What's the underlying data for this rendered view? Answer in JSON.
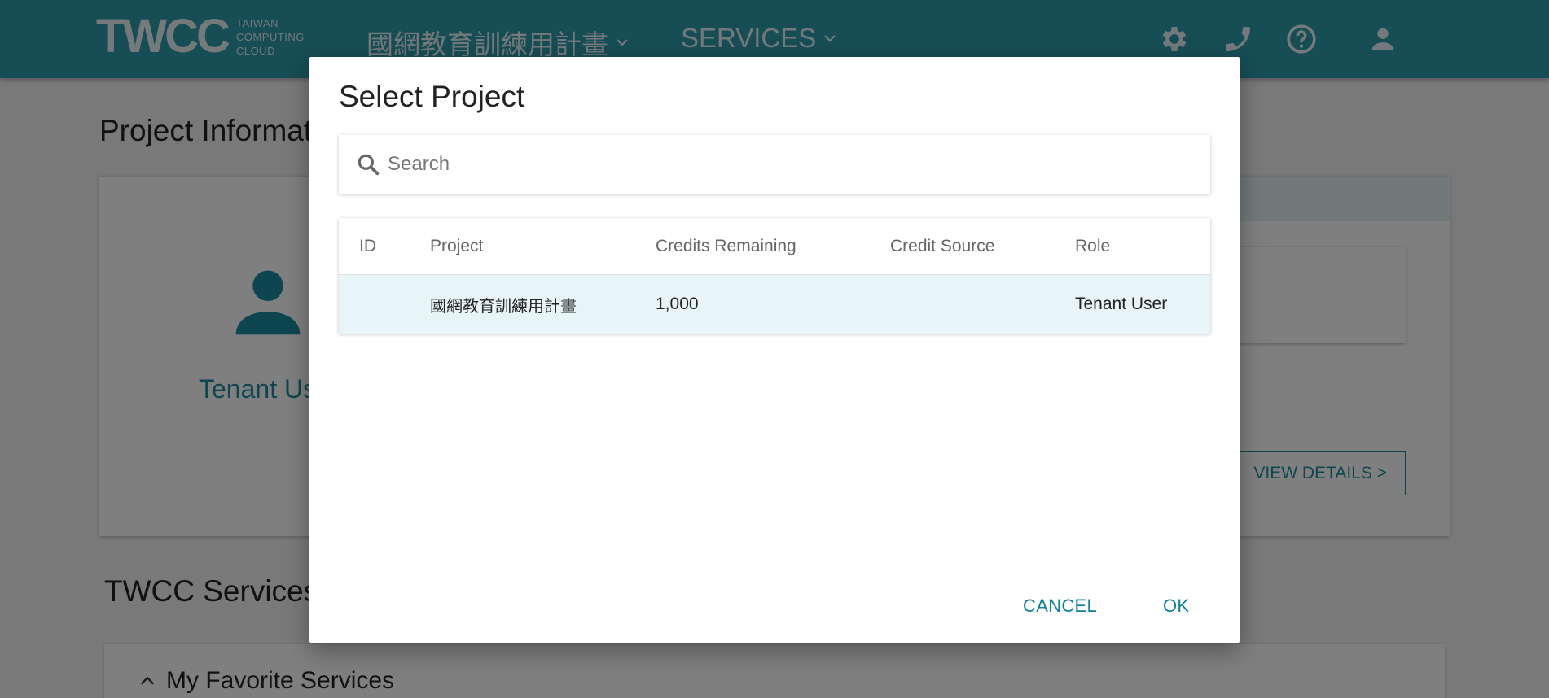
{
  "header": {
    "logo_text": "TWCC",
    "logo_sub": [
      "TAIWAN",
      "COMPUTING",
      "CLOUD"
    ],
    "project_menu_label": "國網教育訓練用計畫",
    "services_menu_label": "SERVICES",
    "icons": [
      "gear-icon",
      "phone-icon",
      "help-icon",
      "account-icon"
    ]
  },
  "page": {
    "title": "Project Informati",
    "tenant_label": "Tenant Us",
    "view_details_label": "VIEW DETAILS >",
    "services_title": "TWCC Services",
    "favorites_label": "My Favorite Services"
  },
  "dialog": {
    "title": "Select Project",
    "search": {
      "placeholder": "Search",
      "value": ""
    },
    "columns": [
      "ID",
      "Project",
      "Credits Remaining",
      "Credit Source",
      "Role"
    ],
    "rows": [
      {
        "id": "",
        "project": "國網教育訓練用計畫",
        "credits": "1,000",
        "source": "",
        "role": "Tenant User"
      }
    ],
    "cancel_label": "CANCEL",
    "ok_label": "OK"
  },
  "colors": {
    "header_bg": "#2e9aab",
    "accent": "#117f97",
    "selected_row": "#e7f4f8",
    "overlay": "rgba(0,0,0,0.5)"
  }
}
